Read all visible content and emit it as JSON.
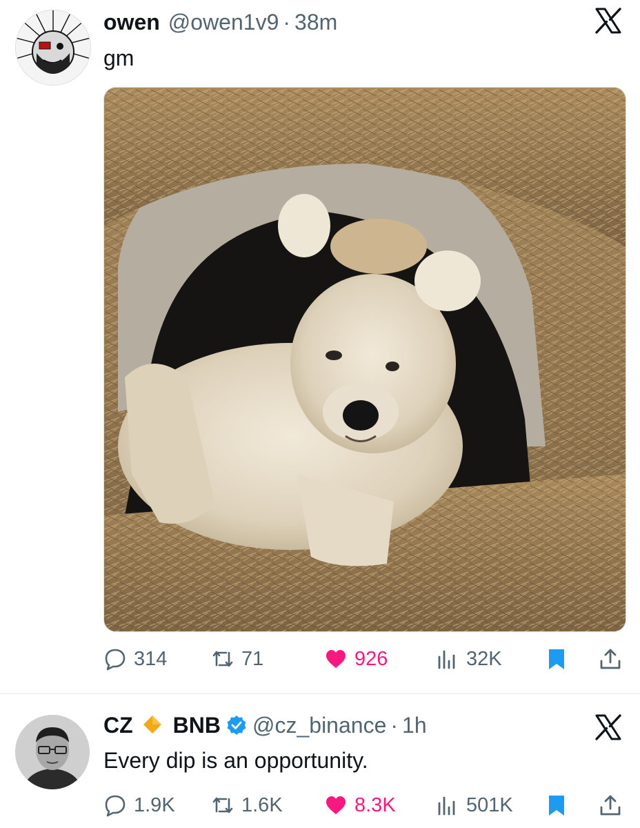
{
  "tweets": [
    {
      "author_name": "owen",
      "handle": "@owen1v9",
      "separator": "·",
      "time": "38m",
      "text": "gm",
      "media": "photo-bear-cub-in-hay",
      "stats": {
        "replies": "314",
        "retweets": "71",
        "likes": "926",
        "views": "32K"
      }
    },
    {
      "author_name": "CZ",
      "name_suffix": "BNB",
      "handle": "@cz_binance",
      "separator": "·",
      "time": "1h",
      "text": "Every dip is an opportunity.",
      "stats": {
        "replies": "1.9K",
        "retweets": "1.6K",
        "likes": "8.3K",
        "views": "501K"
      }
    }
  ],
  "icons": {
    "platform": "x-logo-icon",
    "reply": "speech-bubble-icon",
    "retweet": "retweet-arrows-icon",
    "like": "heart-icon",
    "views": "bar-chart-icon",
    "bookmark": "bookmark-icon",
    "share": "share-upload-icon",
    "badge": "diamond-icon",
    "verified": "verified-badge-icon"
  },
  "colors": {
    "like": "#f91880",
    "bookmark": "#1d9bf0",
    "muted": "#536471",
    "text": "#0f1419",
    "diamond": "#f3a81a"
  }
}
